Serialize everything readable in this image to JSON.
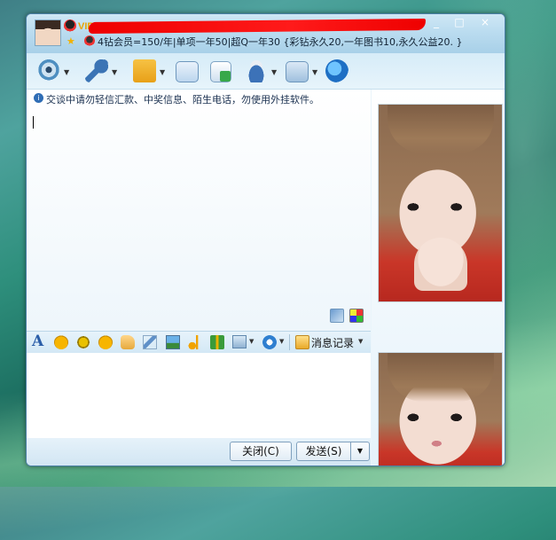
{
  "titlebar": {
    "vip_label": "VIP",
    "signature": "4钻会员=150/年|单项一年50|超Q一年30 {彩钻永久20,一年图书10,永久公益20. }",
    "window_buttons": [
      "_",
      "□",
      "×"
    ]
  },
  "toolbar": {
    "items": [
      "camera-icon",
      "microphone-icon",
      "folder-icon",
      "mail-icon",
      "add-card-icon",
      "hat-icon",
      "app-icon",
      "browser-icon"
    ]
  },
  "chat": {
    "notice_icon": "i",
    "notice": "交谈中请勿轻信汇款、中奖信息、陌生电话，勿使用外挂软件。"
  },
  "format_bar": {
    "font_icon_label": "A",
    "history_label": "消息记录",
    "dropdown_arrow": "▼"
  },
  "buttons": {
    "close": "关闭(C)",
    "send": "发送(S)",
    "send_arrow": "▼"
  },
  "colors": {
    "accent": "#2f6db5",
    "name_redaction": "#e00000"
  }
}
